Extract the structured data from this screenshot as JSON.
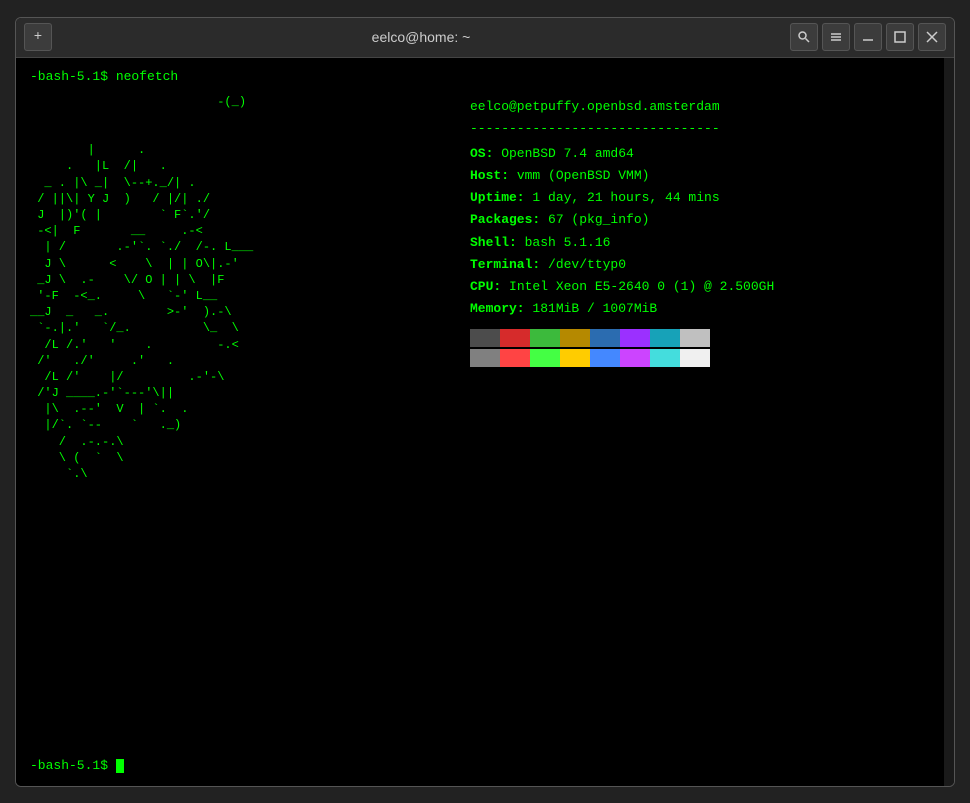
{
  "window": {
    "title": "eelco@home: ~",
    "add_tab_icon": "+",
    "search_icon": "🔍",
    "menu_icon": "☰",
    "minimize_icon": "—",
    "maximize_icon": "□",
    "close_icon": "✕"
  },
  "terminal": {
    "prompt": "-bash-5.1$",
    "command": " neofetch",
    "ascii_art": "                            -(_)\n\n          |      .\n       .   |L  /|   .\n    _ . |\\  _|  \\--+._/| .\n   / ||\\| Y J  )   / |/| ./\n  J  |)'( |        `  F`.'/\n  -<|  F       __     .-<\n   | /       .-'`. `./  /-. L___\n   J \\      <    \\  | | O\\|.-'\n  _J \\  .-    \\/ O | | \\  |F\n  '-F  -<_.     \\   `-' L__\n__J  _   _.        >-'  ).-\\ \n `-.| .'   `/_.          \\_  \\\n  /L /.'   '    .         -.<\n /'   ./'     .'   .\n  /L /'    |/         .-'-\\\n /'J ____.-'`---'\\||\n  |\\  .--'  V  | `.  .\n  |/`. `--    `   ._)\n    /  .-.-.\\\n    \\ (  `  \\\n     `.\\ ",
    "username_host": "eelco@petpuffy.openbsd.amsterdam",
    "separator": "--------------------------------",
    "info": {
      "os_key": "OS:",
      "os_value": " OpenBSD 7.4 amd64",
      "host_key": "Host:",
      "host_value": " vmm (OpenBSD VMM)",
      "uptime_key": "Uptime:",
      "uptime_value": " 1 day, 21 hours, 44 mins",
      "packages_key": "Packages:",
      "packages_value": " 67 (pkg_info)",
      "shell_key": "Shell:",
      "shell_value": " bash 5.1.16",
      "terminal_key": "Terminal:",
      "terminal_value": " /dev/ttyp0",
      "cpu_key": "CPU:",
      "cpu_value": " Intel Xeon E5-2640 0 (1) @ 2.500GH",
      "memory_key": "Memory:",
      "memory_value": " 181MiB / 1007MiB"
    },
    "palette": {
      "row1": [
        "#4c4c4c",
        "#d62b2b",
        "#3cba3c",
        "#b58900",
        "#2b6cb0",
        "#9b30ff",
        "#17a2b8",
        "#c0c0c0"
      ],
      "row2": [
        "#808080",
        "#ff4444",
        "#44ff44",
        "#ffcc00",
        "#4488ff",
        "#cc44ff",
        "#44dddd",
        "#f0f0f0"
      ]
    },
    "bottom_prompt": "-bash-5.1$ "
  }
}
